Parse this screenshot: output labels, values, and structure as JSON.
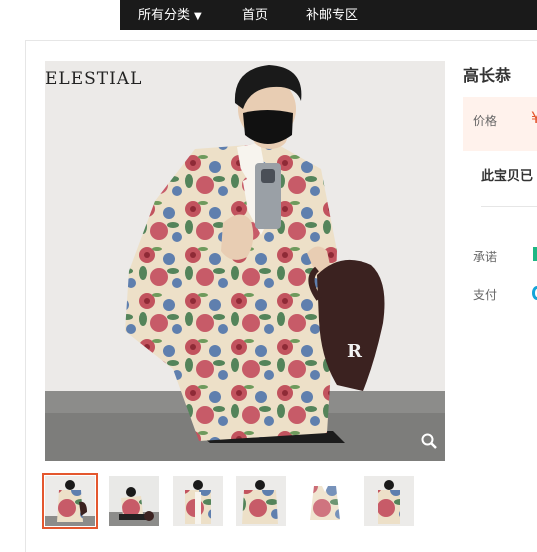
{
  "nav": {
    "category_label": "所有分类",
    "home_label": "首页",
    "zone_label": "补邮专区"
  },
  "product": {
    "title": "高长恭",
    "brand_logo": "ELESTIAL",
    "cap_letter": "R",
    "price_label": "价格",
    "price_symbol": "¥",
    "sold_text": "此宝贝已",
    "promise_label": "承诺",
    "payment_label": "支付"
  },
  "gallery": {
    "thumb_count": 6,
    "active_index": 0
  },
  "colors": {
    "accent": "#e4572e",
    "nav_bg": "#1a1a1a",
    "promise": "#1db784",
    "payment": "#14a5d9"
  }
}
